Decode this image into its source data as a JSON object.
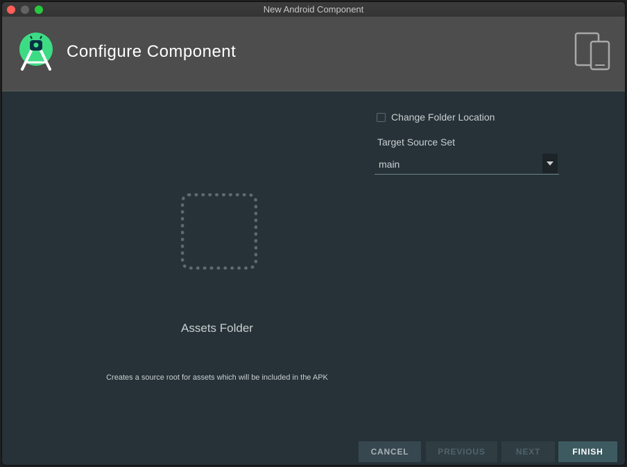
{
  "window": {
    "title": "New Android Component"
  },
  "header": {
    "title": "Configure Component",
    "logo_icon": "android-studio-logo-icon",
    "device_icon": "tablet-phone-icon"
  },
  "component": {
    "name": "Assets Folder",
    "description": "Creates a source root for assets which will be included in the APK",
    "preview_icon": "dotted-square-placeholder-icon"
  },
  "form": {
    "change_folder": {
      "label": "Change Folder Location",
      "checked": false
    },
    "target_source_set": {
      "label": "Target Source Set",
      "value": "main"
    }
  },
  "footer": {
    "cancel": "CANCEL",
    "previous": "PREVIOUS",
    "next": "NEXT",
    "finish": "FINISH"
  },
  "colors": {
    "background": "#263238",
    "header": "#4d4d4d",
    "accent_green": "#3ddc84",
    "finish_button": "#3d5a61"
  }
}
